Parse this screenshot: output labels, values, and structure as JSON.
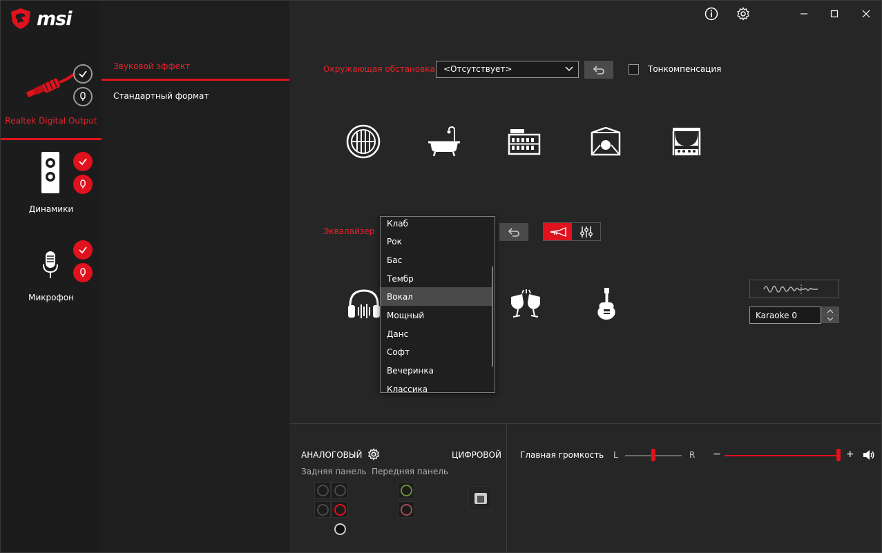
{
  "app": {
    "brand": "msi"
  },
  "titlebar": {
    "info_icon": "info-icon",
    "settings_icon": "gear-icon",
    "minimize_icon": "minimize-icon",
    "maximize_icon": "maximize-icon",
    "close_icon": "close-icon"
  },
  "devices": [
    {
      "label": "Realtek Digital Output",
      "active": true
    },
    {
      "label": "Динамики",
      "active": false
    },
    {
      "label": "Микрофон",
      "active": false
    }
  ],
  "functions": {
    "sound_effect": "Звуковой эффект",
    "standard_format": "Стандартный формат"
  },
  "environment": {
    "label": "Окружающая обстановка",
    "selected": "<Отсутствует>",
    "loudness_label": "Тонкомпенсация",
    "loudness_checked": false,
    "icons": [
      "stadium-icon",
      "bathroom-icon",
      "colosseum-icon",
      "stage-icon",
      "theater-icon"
    ]
  },
  "equalizer": {
    "label": "Эквалайзер",
    "options": [
      "Клаб",
      "Рок",
      "Бас",
      "Тембр",
      "Вокал",
      "Мощный",
      "Данс",
      "Софт",
      "Вечеринка",
      "Классика"
    ],
    "highlighted": "Вокал",
    "icons": [
      "headphones-icon",
      "cheers-icon",
      "guitar-icon"
    ],
    "karaoke_value": "Karaoke 0"
  },
  "bottom": {
    "analog_label": "АНАЛОГОВЫЙ",
    "digital_label": "ЦИФРОВОЙ",
    "rear_panel": "Задняя панель",
    "front_panel": "Передняя панель",
    "master_volume": "Главная громкость",
    "balance_left": "L",
    "balance_right": "R",
    "minus": "−",
    "plus": "+",
    "balance_level": 0.5,
    "volume_level": 1.0
  },
  "colors": {
    "accent": "#e0121d",
    "bg": "#262626",
    "sidebar": "#1c1c1c"
  }
}
